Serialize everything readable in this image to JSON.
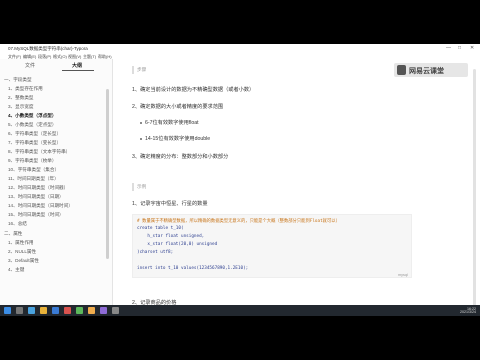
{
  "window": {
    "title": "07.MySQL数据类型字符串(char)-Typora",
    "controls": [
      "—",
      "□",
      "✕"
    ]
  },
  "menu": [
    "文件(F)",
    "编辑(E)",
    "段落(P)",
    "格式(O)",
    "视图(V)",
    "主题(T)",
    "帮助(H)"
  ],
  "sidebar": {
    "tabs": [
      "文件",
      "大纲"
    ],
    "active_tab": "大纲",
    "outline": [
      {
        "label": "一、字段类型",
        "bold": false
      },
      {
        "label": "1、类型存在作用",
        "bold": false
      },
      {
        "label": "2、整数类型",
        "bold": false
      },
      {
        "label": "3、显示宽度",
        "bold": false
      },
      {
        "label": "4、小数类型（浮点型）",
        "bold": true
      },
      {
        "label": "5、小数类型（定点型）",
        "bold": false
      },
      {
        "label": "6、字符串类型（定长型）",
        "bold": false
      },
      {
        "label": "7、字符串类型（变长型）",
        "bold": false
      },
      {
        "label": "8、字符串类型（文本字符串）",
        "bold": false
      },
      {
        "label": "9、字符串类型（枚举）",
        "bold": false
      },
      {
        "label": "10、字符串类型（集合）",
        "bold": false
      },
      {
        "label": "11、时间日期类型（年）",
        "bold": false
      },
      {
        "label": "12、时间日期类型（时间戳）",
        "bold": false
      },
      {
        "label": "13、时间日期类型（日期）",
        "bold": false
      },
      {
        "label": "14、时间日期类型（日期时间）",
        "bold": false
      },
      {
        "label": "15、时间日期类型（时间）",
        "bold": false
      },
      {
        "label": "16、总结",
        "bold": false
      },
      {
        "label": "二、属性",
        "bold": false
      },
      {
        "label": "1、属性作用",
        "bold": false
      },
      {
        "label": "2、NULL属性",
        "bold": false
      },
      {
        "label": "3、Default属性",
        "bold": false
      },
      {
        "label": "4、主键",
        "bold": false
      }
    ]
  },
  "editor": {
    "section1_label": "步骤",
    "steps": [
      "1、确定当前设计的数据为不精确型数据（或者小数）",
      "2、确定数据的大小或者精度的要求范围"
    ],
    "bullets": [
      "6-7位有效数字使用float",
      "14-15位有效数字使用double"
    ],
    "step3": "3、确定精度的分布：整数部分和小数部分",
    "section2_label": "示例",
    "example1": "1、记录宇宙中恒星、行星的数量",
    "code_lines": [
      "# 数量属于不精确型数据，所以精确的数据类型无意义的，只能是个大概（整数部分只能到Float就可以）",
      "create table t_10(",
      "    h_star float unsigned,",
      "    x_star float(20,0) unsigned",
      ")charset utf8;",
      "",
      "insert into t_10 values(1234567890,1.2E10);"
    ],
    "code_lang": "mysql",
    "example2": "2、记录商品的价格",
    "logo": "网易云课堂"
  },
  "taskbar": {
    "time": "16:22",
    "date": "2021/3/24"
  }
}
